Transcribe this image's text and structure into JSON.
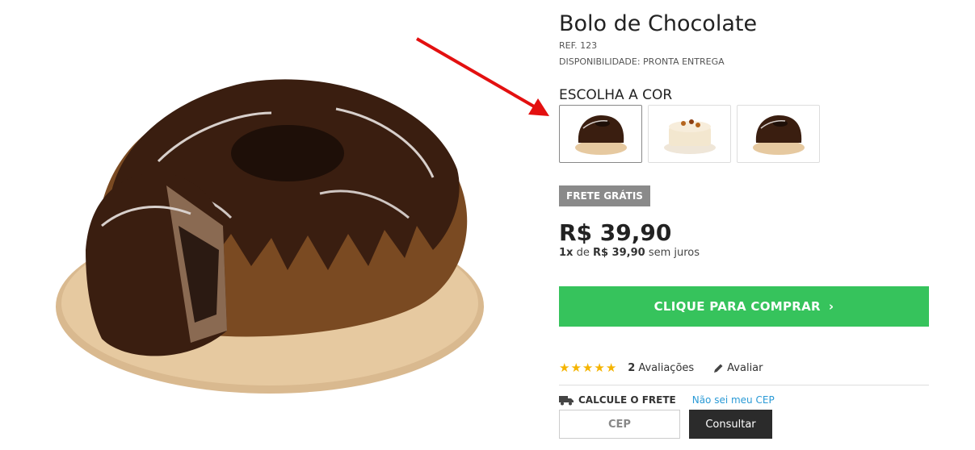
{
  "product": {
    "title": "Bolo de Chocolate",
    "ref": "REF. 123",
    "availability": "DISPONIBILIDADE: PRONTA ENTREGA",
    "choose_label": "ESCOLHA A COR",
    "badge": "FRETE GRÁTIS",
    "price": "R$ 39,90",
    "installments": {
      "count": "1x",
      "de": "de",
      "value": "R$ 39,90",
      "suffix": "sem juros"
    },
    "buy_label": "CLIQUE PARA COMPRAR",
    "buy_chevron": "›"
  },
  "rating": {
    "stars": 5,
    "count": "2",
    "label": "Avaliações",
    "rate_label": "Avaliar"
  },
  "shipping": {
    "label": "CALCULE O FRETE",
    "link": "Não sei meu CEP",
    "cep_placeholder": "CEP",
    "consult_label": "Consultar"
  },
  "colors": {
    "accent_green": "#36c35c",
    "badge_gray": "#8a8a8a",
    "link_blue": "#2a9ad6",
    "star": "#f5b400",
    "arrow": "#e31010"
  }
}
